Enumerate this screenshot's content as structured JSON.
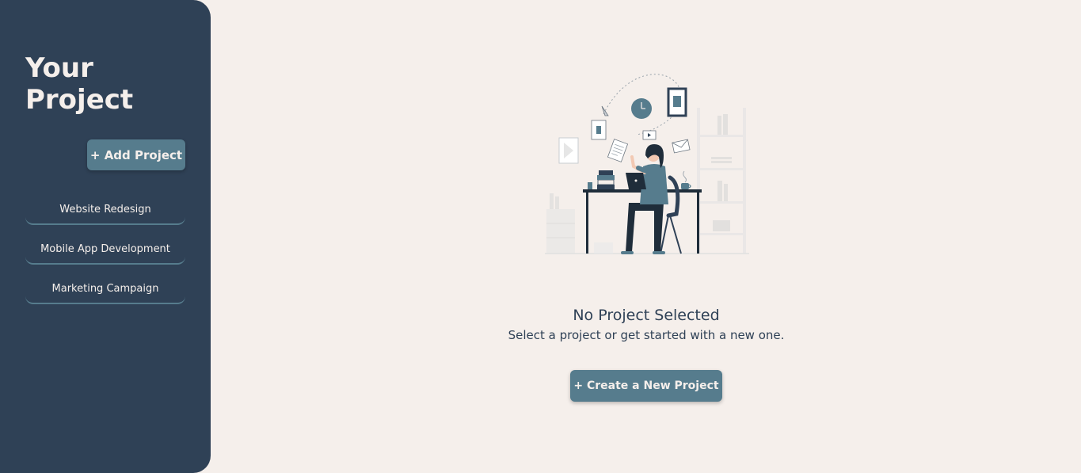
{
  "sidebar": {
    "title": "Your Project",
    "add_button_label": "+ Add Project",
    "projects": [
      {
        "label": "Website Redesign"
      },
      {
        "label": "Mobile App Development"
      },
      {
        "label": "Marketing Campaign"
      }
    ]
  },
  "main": {
    "illustration_icon": "person-working-at-desk-illustration",
    "empty_title": "No Project Selected",
    "empty_subtitle": "Select a project or get started with a new one.",
    "create_button_label": "+ Create a New Project"
  },
  "colors": {
    "sidebar_bg": "#2f4156",
    "accent": "#567c8d",
    "page_bg": "#f5efeb",
    "text_light": "#f5efeb",
    "text_dark": "#2f4156"
  }
}
